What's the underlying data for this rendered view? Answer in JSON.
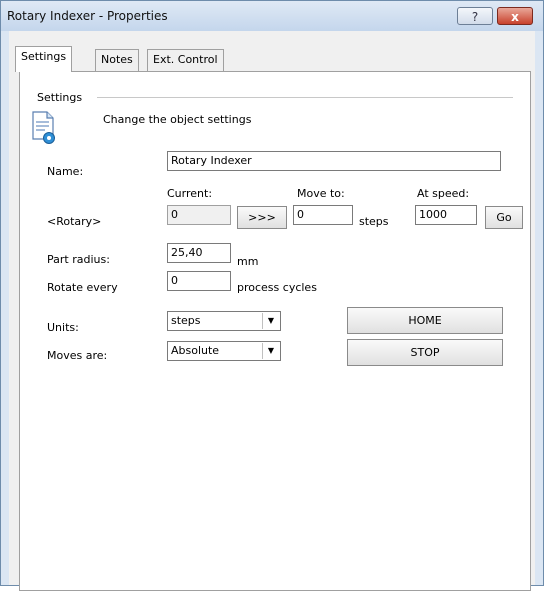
{
  "window": {
    "title": "Rotary Indexer - Properties",
    "help_label": "?",
    "close_label": "x",
    "close_color": "#c8412c"
  },
  "tabs": [
    {
      "label": "Settings",
      "active": true
    },
    {
      "label": "Notes",
      "active": false
    },
    {
      "label": "Ext. Control",
      "active": false
    }
  ],
  "settings": {
    "group_title": "Settings",
    "description": "Change the object settings",
    "icon": "settings-document-icon",
    "name_label": "Name:",
    "name_value": "Rotary Indexer",
    "current_header": "Current:",
    "move_to_header": "Move to:",
    "at_speed_header": "At speed:",
    "axis_label": "<Rotary>",
    "current_value": "0",
    "move_button_label": ">>>",
    "move_to_value": "0",
    "steps_unit": "steps",
    "speed_value": "1000",
    "go_button_label": "Go",
    "part_radius_label": "Part radius:",
    "part_radius_value": "25,40",
    "part_radius_unit": "mm",
    "rotate_every_label": "Rotate every",
    "rotate_every_value": "0",
    "rotate_every_unit": "process cycles",
    "units_label": "Units:",
    "units_value": "steps",
    "moves_label": "Moves are:",
    "moves_value": "Absolute",
    "home_button_label": "HOME",
    "stop_button_label": "STOP"
  }
}
